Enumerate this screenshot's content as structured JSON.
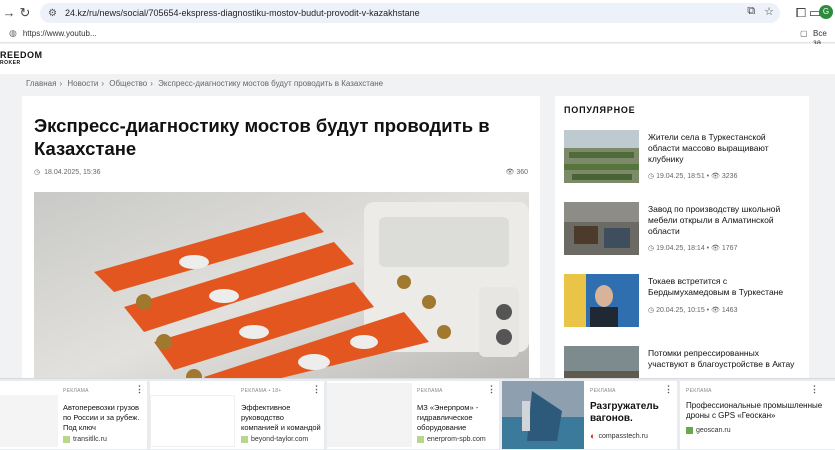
{
  "browser": {
    "url": "24.kz/ru/news/social/705654-ekspress-diagnostiku-mostov-budut-provodit-v-kazakhstane",
    "bookmark": "https://www.youtub...",
    "bookmarks_right": "Все за",
    "profile_letter": "G"
  },
  "site": {
    "logo_top": "REEDOM",
    "logo_bottom": "ROKER"
  },
  "breadcrumb": [
    "Главная",
    "Новости",
    "Общество",
    "Экспресс-диагностику мостов будут проводить в Казахстане"
  ],
  "article": {
    "title": "Экспресс-диагностику мостов будут проводить в Казахстане",
    "date": "18.04.2025, 15:36",
    "views": "360"
  },
  "popular": {
    "heading": "ПОПУЛЯРНОЕ",
    "items": [
      {
        "title": "Жители села в Туркестанской области массово выращивают клубнику",
        "date": "19.04.25, 18:51",
        "views": "3236"
      },
      {
        "title": "Завод по производству школьной мебели открыли в Алматинской области",
        "date": "19.04.25, 18:14",
        "views": "1767"
      },
      {
        "title": "Токаев встретится с Бердымухамедовым в Туркестане",
        "date": "20.04.25, 10:15",
        "views": "1463"
      },
      {
        "title": "Потомки репрессированных участвуют в благоустройстве в Актау",
        "date": "",
        "views": ""
      }
    ]
  },
  "ads": [
    {
      "label": "РЕКЛАМА",
      "text": "Автоперевозки грузов по России и за рубеж. Под ключ",
      "domain": "transitllc.ru"
    },
    {
      "label": "РЕКЛАМА • 18+",
      "text": "Эффективное руководство компанией и командой",
      "domain": "beyond-taylor.com"
    },
    {
      "label": "РЕКЛАМА",
      "text": "МЗ «Энерпром» - гидравлическое оборудование",
      "domain": "enerprom-spb.com"
    },
    {
      "label": "РЕКЛАМА",
      "text": "Разгружатель вагонов.",
      "domain": "compasstech.ru"
    },
    {
      "label": "РЕКЛАМА",
      "text": "Профессиональные промышленные дроны с GPS «Геоскан»",
      "domain": "geoscan.ru"
    }
  ]
}
